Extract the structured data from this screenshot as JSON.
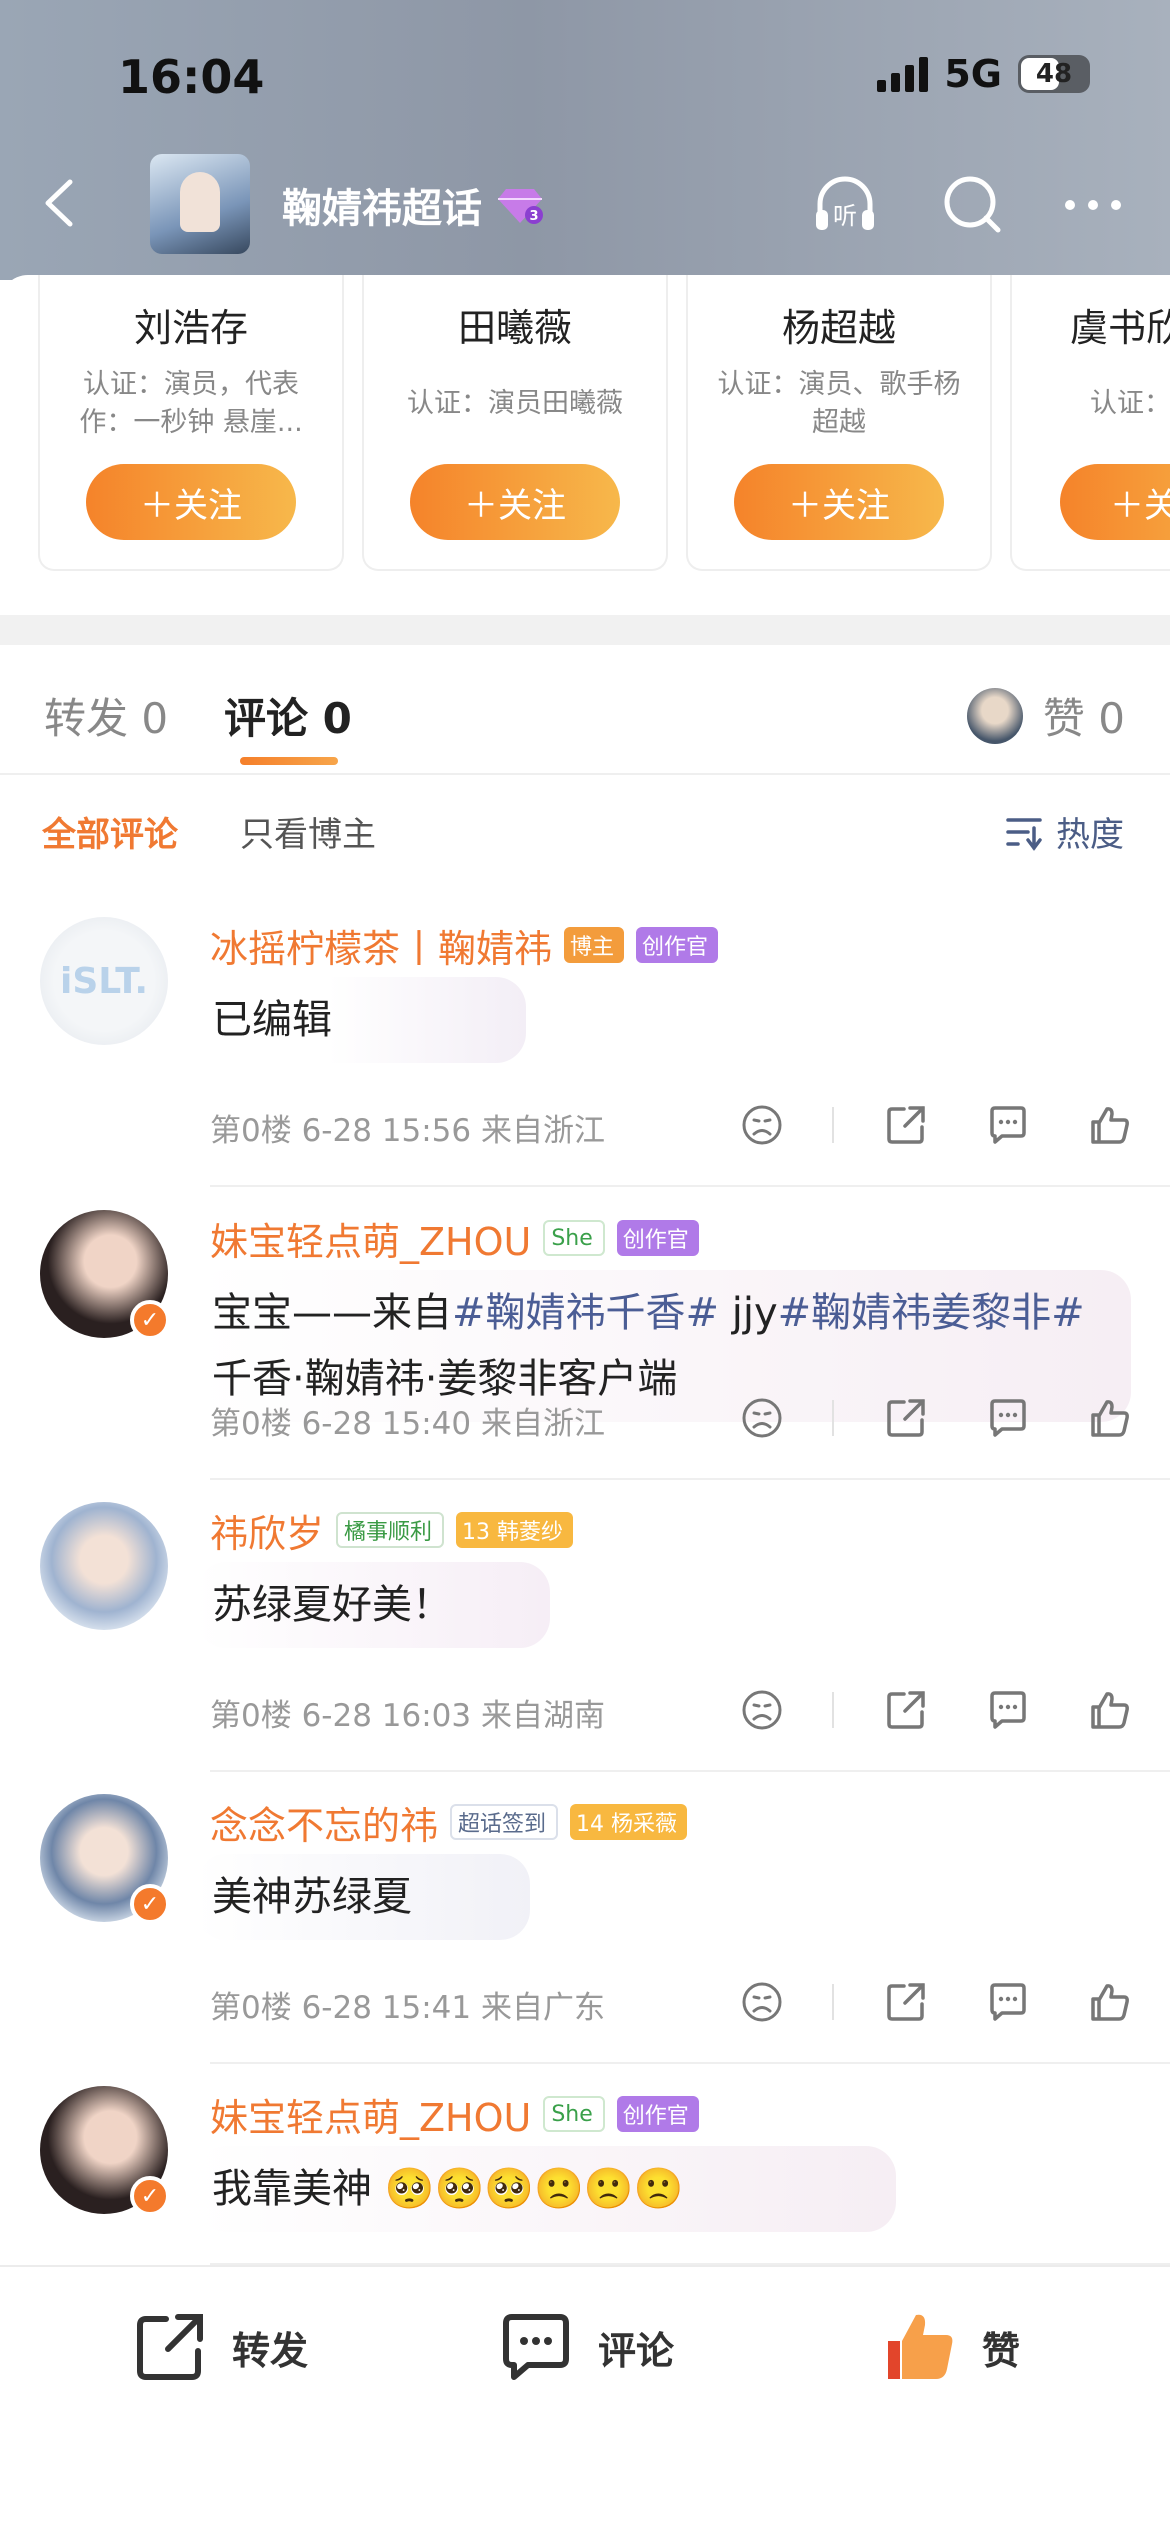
{
  "status_bar": {
    "time": "16:04",
    "network": "5G",
    "battery": "48"
  },
  "nav": {
    "title": "鞠婧祎超话",
    "icons": [
      "back-icon",
      "listen-icon",
      "search-icon",
      "more-icon"
    ],
    "listen_label": "听"
  },
  "recommend_cards": [
    {
      "name": "刘浩存",
      "desc": "认证：演员，代表作：一秒钟 悬崖...",
      "follow": "＋关注"
    },
    {
      "name": "田曦薇",
      "desc": "认证：演员田曦薇",
      "follow": "＋关注"
    },
    {
      "name": "杨超越",
      "desc": "认证：演员、歌手杨超越",
      "follow": "＋关注"
    },
    {
      "name": "虞书欣",
      "desc": "认证：",
      "follow": "＋关"
    }
  ],
  "tabs": {
    "repost": "转发 0",
    "comment": "评论 0",
    "like": "赞 0"
  },
  "filters": {
    "all": "全部评论",
    "blogger_only": "只看博主",
    "sort": "热度"
  },
  "comments": [
    {
      "name": "冰摇柠檬茶丨鞠婧祎",
      "badges": [
        "博主",
        "创作官"
      ],
      "segments": [
        {
          "t": "已编辑",
          "h": false
        }
      ],
      "meta": "第0楼 6-28 15:56 来自浙江",
      "avatar_text": "iSLT."
    },
    {
      "name": "妹宝轻点萌_ZHOU",
      "badges": [
        "She",
        "创作官"
      ],
      "segments": [
        {
          "t": "宝宝——来自",
          "h": false
        },
        {
          "t": "#鞠婧祎千香#",
          "h": true
        },
        {
          "t": " jjy",
          "h": false
        },
        {
          "t": "#鞠婧祎姜黎非#",
          "h": true
        },
        {
          "t": " 千香·鞠婧祎·姜黎非客户端",
          "h": false
        }
      ],
      "meta": "第0楼 6-28 15:40 来自浙江"
    },
    {
      "name": "祎欣岁",
      "badges": [
        "橘事顺利",
        "13 韩菱纱"
      ],
      "segments": [
        {
          "t": "苏绿夏好美！",
          "h": false
        }
      ],
      "meta": "第0楼 6-28 16:03 来自湖南"
    },
    {
      "name": "念念不忘的祎",
      "badges": [
        "超话签到",
        "14 杨采薇"
      ],
      "segments": [
        {
          "t": "美神苏绿夏",
          "h": false
        }
      ],
      "meta": "第0楼 6-28 15:41 来自广东"
    },
    {
      "name": "妹宝轻点萌_ZHOU",
      "badges": [
        "She",
        "创作官"
      ],
      "segments": [
        {
          "t": "我靠美神 🥺🥺🥺🙁🙁🙁",
          "h": false
        }
      ],
      "meta": ""
    }
  ],
  "bottom_bar": {
    "repost": "转发",
    "comment": "评论",
    "like": "赞"
  },
  "colors": {
    "accent": "#f07932",
    "hashtag": "#4b5d95",
    "follow_start": "#f5832a",
    "follow_end": "#f7b84b"
  }
}
